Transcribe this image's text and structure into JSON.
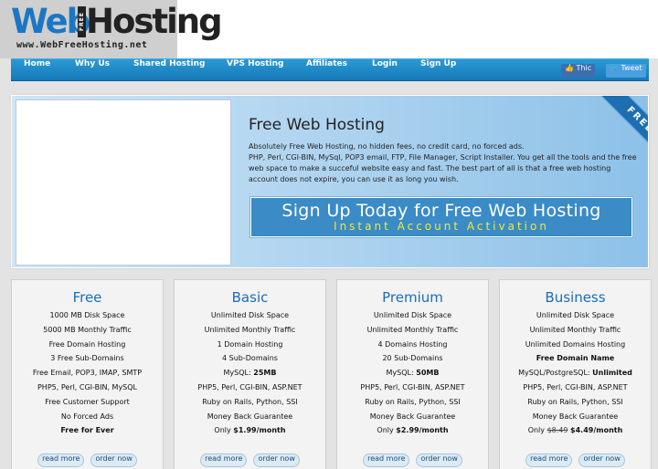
{
  "logo": {
    "web": "Web",
    "free": "FREE",
    "hosting": "Hosting",
    "url": "www.WebFreeHosting.net"
  },
  "nav": {
    "items": [
      "Home",
      "Why Us",
      "Shared Hosting",
      "VPS Hosting",
      "Affiliates",
      "Login",
      "Sign Up"
    ],
    "facebook_label": "Thic",
    "twitter_label": "Tweet"
  },
  "hero": {
    "title": "Free Web Hosting",
    "line1": "Absolutely Free Web Hosting, no hidden fees, no credit card, no forced ads.",
    "line2": "PHP, Perl, CGI-BIN, MySql, POP3 email, FTP, File Manager, Script Installer. You get all the tools and the free web space to make a succeful website easy and fast. The best part of all is that a free web hosting account does not expire, you can use it as long you wish.",
    "cta_main": "Sign Up Today for Free Web Hosting",
    "cta_sub": "Instant Account Activation",
    "ribbon": "FREE"
  },
  "plans": [
    {
      "name": "Free",
      "features": [
        "1000 MB Disk Space",
        "5000 MB Monthly Traffic",
        "Free Domain Hosting",
        "3 Free Sub-Domains",
        "Free Email, POP3, IMAP, SMTP",
        "PHP5, Perl, CGI-BIN, MySQL",
        "Free Customer Support",
        "No Forced Ads"
      ],
      "last": "Free for Ever",
      "read_more": "read more",
      "order_now": "order now"
    },
    {
      "name": "Basic",
      "features": [
        "Unlimited Disk Space",
        "Unlimited Monthly Traffic",
        "1 Domain Hosting",
        "4 Sub-Domains"
      ],
      "mysql_label": "MySQL: ",
      "mysql_value": "25MB",
      "features2": [
        "PHP5, Perl, CGI-BIN, ASP.NET",
        "Ruby on Rails, Python, SSI",
        "Money Back Guarantee"
      ],
      "price_prefix": "Only ",
      "price": "$1.99/month",
      "read_more": "read more",
      "order_now": "order now"
    },
    {
      "name": "Premium",
      "features": [
        "Unlimited Disk Space",
        "Unlimited Monthly Traffic",
        "4 Domains Hosting",
        "20 Sub-Domains"
      ],
      "mysql_label": "MySQL: ",
      "mysql_value": "50MB",
      "features2": [
        "PHP5, Perl, CGI-BIN, ASP.NET",
        "Ruby on Rails, Python, SSI",
        "Money Back Guarantee"
      ],
      "price_prefix": "Only ",
      "price": "$2.99/month",
      "read_more": "read more",
      "order_now": "order now"
    },
    {
      "name": "Business",
      "features": [
        "Unlimited Disk Space",
        "Unlimited Monthly Traffic",
        "Unlimited Domains Hosting"
      ],
      "domain_bold": "Free Domain Name",
      "mysql_label": "MySQL/PostgreSQL: ",
      "mysql_value": "Unlimited",
      "features2": [
        "PHP5, Perl, CGI-BIN, ASP.NET",
        "Ruby on Rails, Python, SSI",
        "Money Back Guarantee"
      ],
      "price_prefix": "Only ",
      "old_price": "$8.49",
      "price": "$4.49/month",
      "read_more": "read more",
      "order_now": "order now"
    }
  ]
}
